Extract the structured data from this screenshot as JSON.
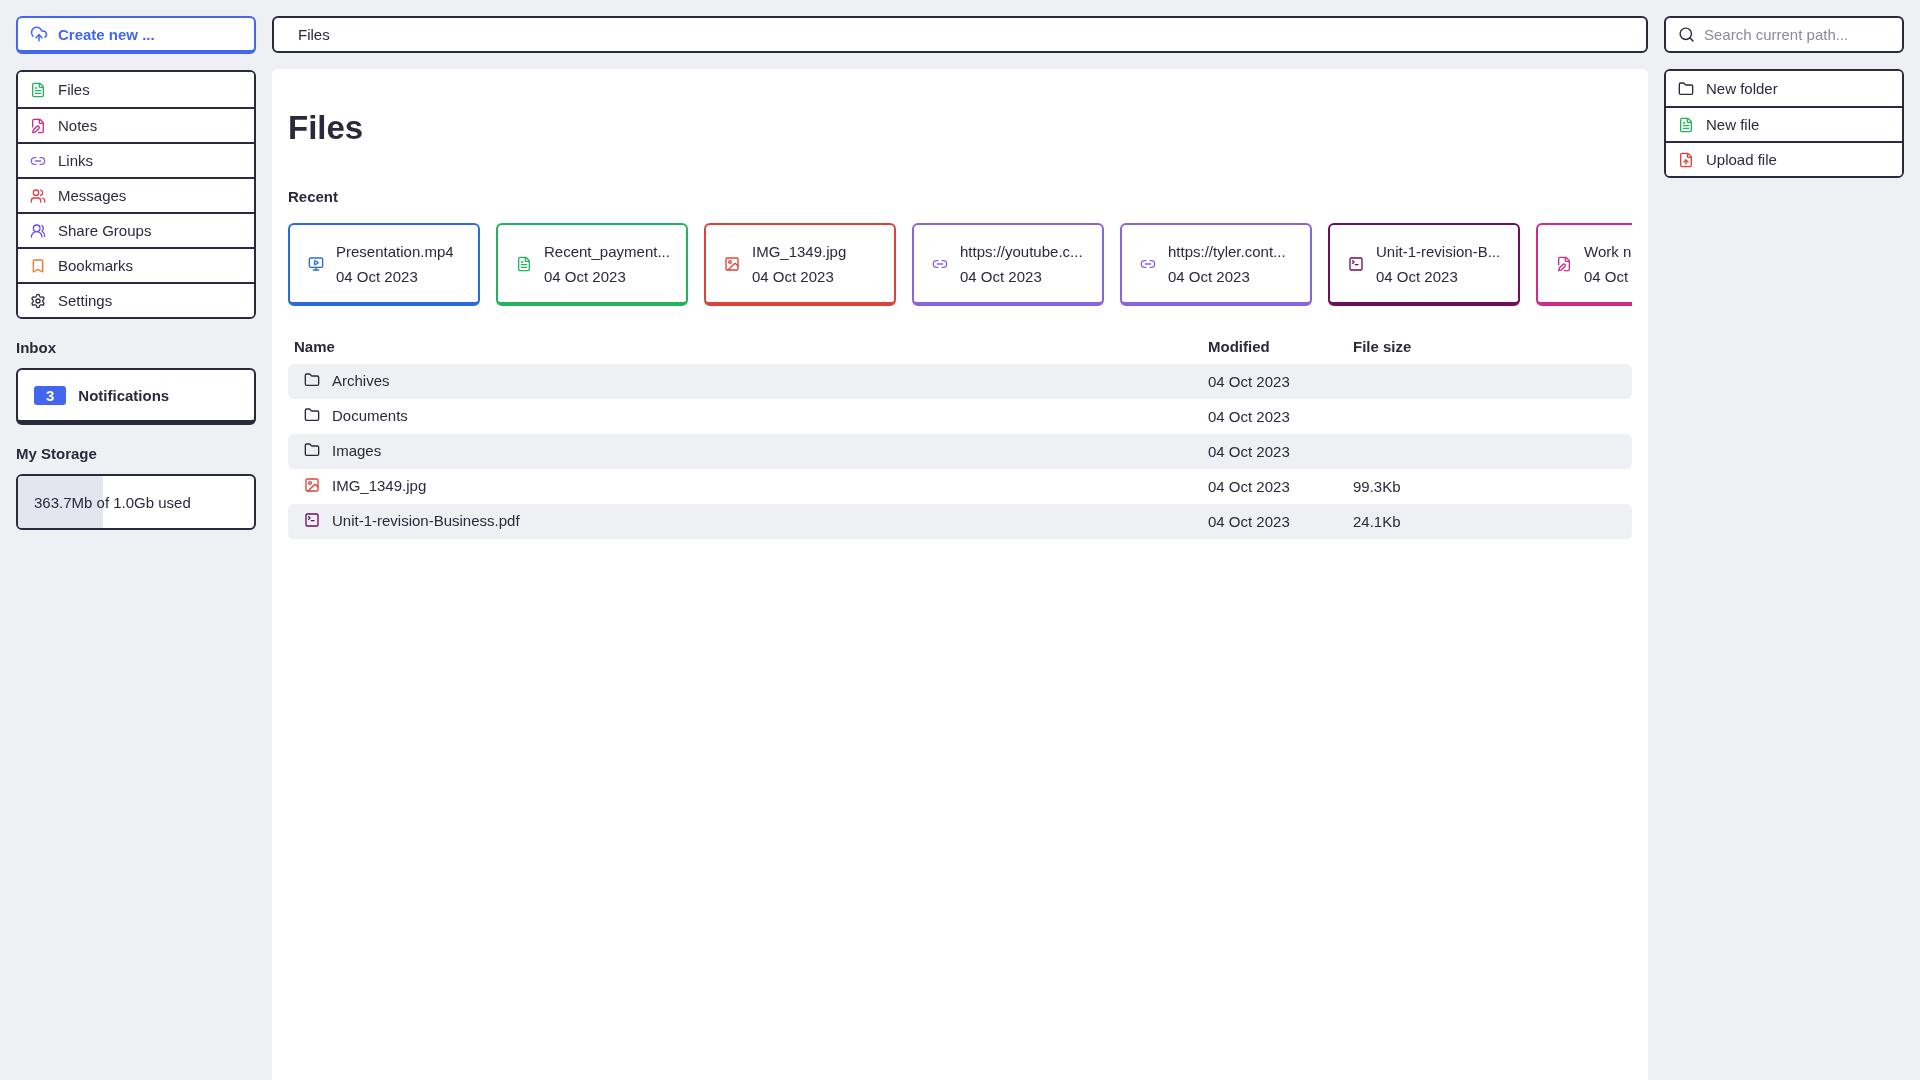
{
  "create_button": {
    "label": "Create new ..."
  },
  "nav": [
    {
      "label": "Files",
      "kind": "file",
      "selected": false
    },
    {
      "label": "Notes",
      "kind": "note",
      "selected": false
    },
    {
      "label": "Links",
      "kind": "link",
      "selected": false
    },
    {
      "label": "Messages",
      "kind": "messages",
      "selected": false
    },
    {
      "label": "Share Groups",
      "kind": "groups",
      "selected": false
    },
    {
      "label": "Bookmarks",
      "kind": "bookmark",
      "selected": false
    },
    {
      "label": "Settings",
      "kind": "settings",
      "selected": false
    }
  ],
  "inbox": {
    "heading": "Inbox",
    "count": "3",
    "label": "Notifications"
  },
  "storage": {
    "heading": "My Storage",
    "text": "363.7Mb of 1.0Gb used",
    "level": 0.36
  },
  "path_bar": {
    "value": "Files"
  },
  "search": {
    "placeholder": "Search current path..."
  },
  "actions": [
    {
      "label": "New folder",
      "kind": "folder"
    },
    {
      "label": "New file",
      "kind": "file"
    },
    {
      "label": "Upload file",
      "kind": "upload"
    }
  ],
  "page_title": "Files",
  "recent": {
    "heading": "Recent",
    "items": [
      {
        "kind": "video",
        "name": "Presentation.mp4",
        "date": "04 Oct 2023",
        "color": "#2a6ce0"
      },
      {
        "kind": "document",
        "name": "Recent_payment...",
        "date": "04 Oct 2023",
        "color": "#22b35e"
      },
      {
        "kind": "image",
        "name": "IMG_1349.jpg",
        "date": "04 Oct 2023",
        "color": "#e0423a"
      },
      {
        "kind": "link",
        "name": "https://youtube.c...",
        "date": "04 Oct 2023",
        "color": "#8a63e0"
      },
      {
        "kind": "link",
        "name": "https://tyler.cont...",
        "date": "04 Oct 2023",
        "color": "#8a63e0"
      },
      {
        "kind": "terminal",
        "name": "Unit-1-revision-B...",
        "date": "04 Oct 2023",
        "color": "#6b0f5e"
      },
      {
        "kind": "note",
        "name": "Work n",
        "date": "04 Oct",
        "color": "#d02a8f"
      }
    ]
  },
  "table": {
    "columns": [
      "Name",
      "Modified",
      "File size"
    ],
    "rows": [
      {
        "kind": "folder",
        "name": "Archives",
        "modified": "04 Oct 2023"
      },
      {
        "kind": "folder",
        "name": "Documents",
        "modified": "04 Oct 2023"
      },
      {
        "kind": "folder",
        "name": "Images",
        "modified": "04 Oct 2023"
      },
      {
        "kind": "image",
        "name": "IMG_1349.jpg",
        "modified": "04 Oct 2023",
        "size": "99.3Kb"
      },
      {
        "kind": "terminal",
        "name": "Unit-1-revision-Business.pdf",
        "modified": "04 Oct 2023",
        "size": "24.1Kb"
      }
    ]
  }
}
